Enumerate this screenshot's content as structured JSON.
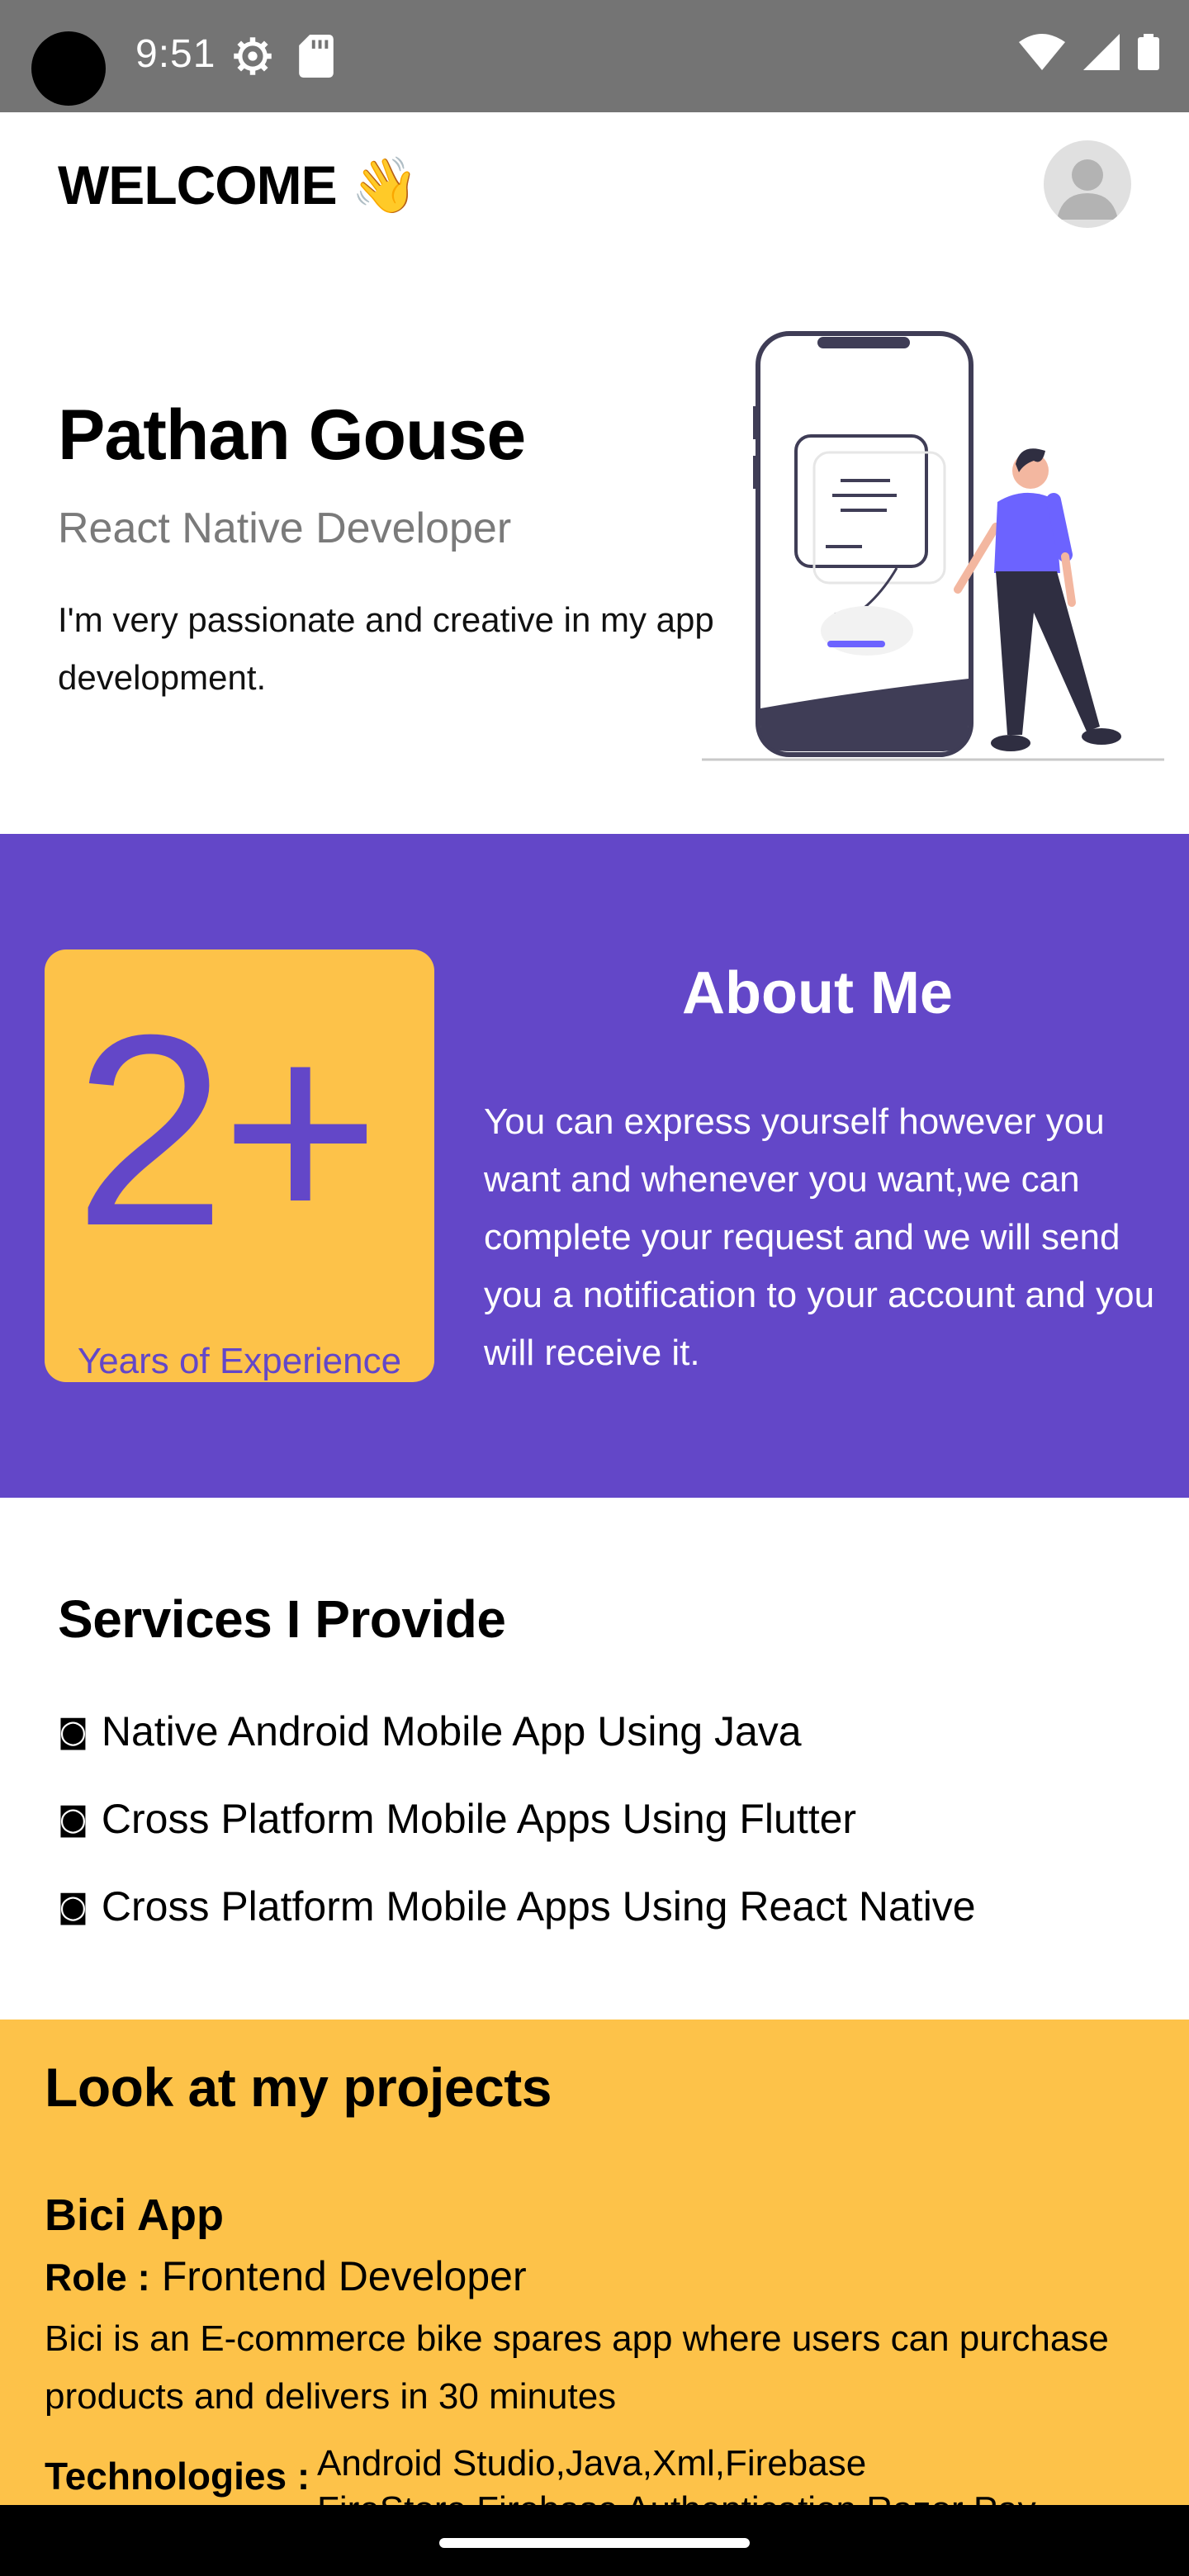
{
  "status_bar": {
    "time": "9:51"
  },
  "header": {
    "welcome": "WELCOME",
    "wave_emoji": "👋",
    "avatar_icon": "user-avatar-icon"
  },
  "hero": {
    "name": "Pathan Gouse",
    "role": "React Native Developer",
    "bio": "I'm very passionate and creative in my app development."
  },
  "about": {
    "experience_number": "2+",
    "experience_label": "Years of Experience",
    "title": "About Me",
    "text": "You can express yourself however you want and whenever you want,we can complete your request and we will send you a notification to your account and you will receive it."
  },
  "services": {
    "title": "Services I Provide",
    "bullet": "◙",
    "items": [
      "Native Android Mobile App Using Java",
      "Cross Platform Mobile Apps Using Flutter",
      "Cross Platform Mobile Apps Using React Native"
    ]
  },
  "projects": {
    "title": "Look at my projects",
    "items": [
      {
        "name": "Bici App",
        "role_label": "Role :",
        "role": "Frontend Developer",
        "description": "Bici is an E-commerce bike spares app where users can purchase products and delivers in 30 minutes",
        "tech_label": "Technologies :",
        "technologies": "Android Studio,Java,Xml,Firebase FireStore,Firebase Authentication,Razor Pay"
      }
    ]
  },
  "colors": {
    "primary": "#6347c8",
    "accent": "#fdc249",
    "status_bar": "#747474"
  }
}
